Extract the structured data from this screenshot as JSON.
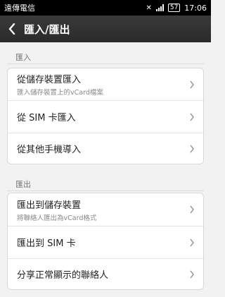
{
  "status": {
    "carrier": "遠傳電信",
    "wifi_icon": "?",
    "battery": "57",
    "time": "17:06"
  },
  "header": {
    "title": "匯入/匯出"
  },
  "import_section": {
    "label": "匯入",
    "items": [
      {
        "label": "從儲存裝置匯入",
        "sub": "匯入儲存裝置上的vCard檔案"
      },
      {
        "label": "從 SIM 卡匯入",
        "sub": ""
      },
      {
        "label": "從其他手機導入",
        "sub": ""
      }
    ]
  },
  "export_section": {
    "label": "匯出",
    "items": [
      {
        "label": "匯出到儲存裝置",
        "sub": "將聯絡人匯出為vCard格式"
      },
      {
        "label": "匯出到 SIM 卡",
        "sub": ""
      },
      {
        "label": "分享正常顯示的聯絡人",
        "sub": ""
      }
    ]
  }
}
